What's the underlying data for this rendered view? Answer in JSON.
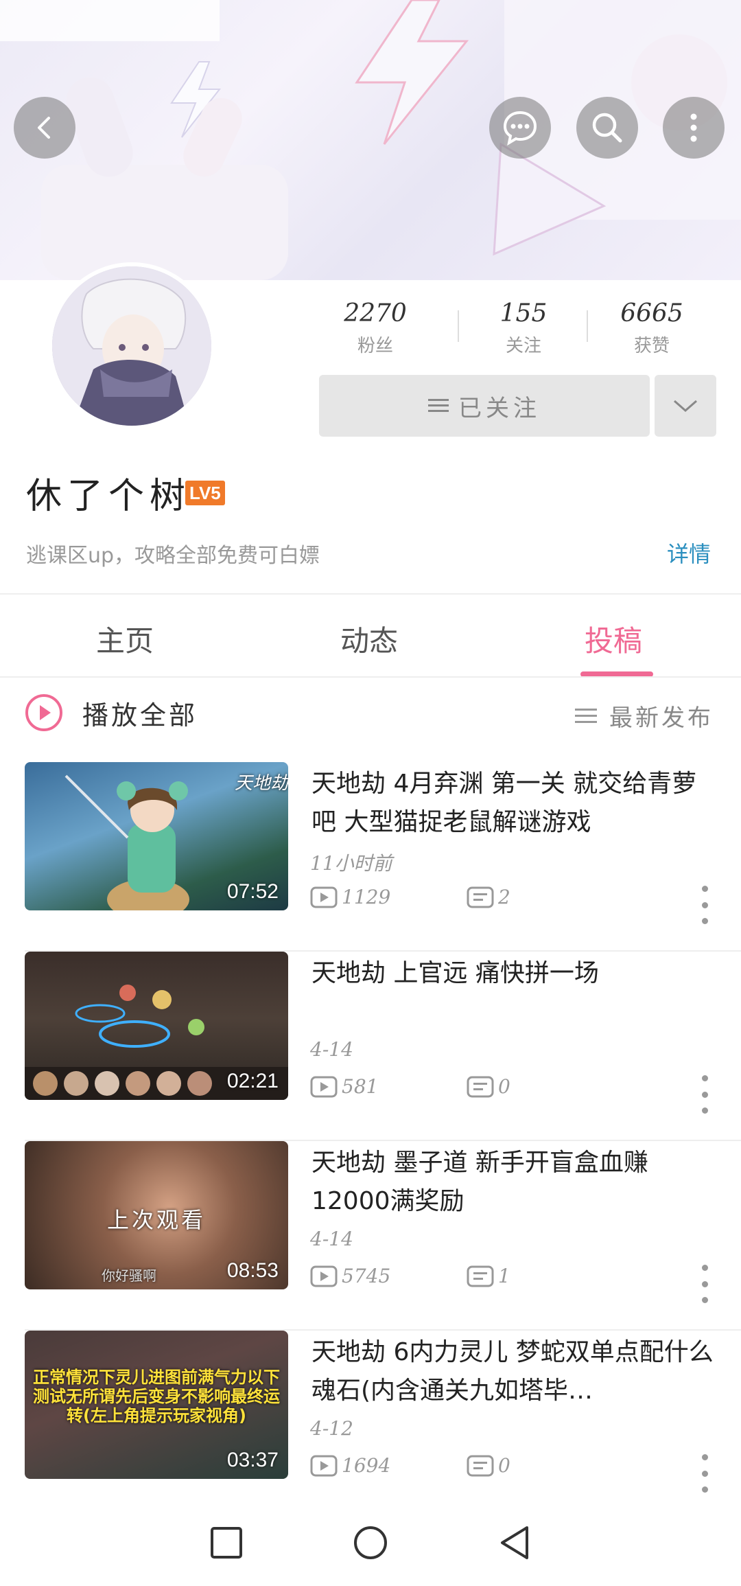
{
  "header": {
    "back_icon": "back-arrow-icon",
    "message_icon": "chat-bubble-icon",
    "search_icon": "search-icon",
    "more_icon": "vertical-dots-icon"
  },
  "profile": {
    "stats": [
      {
        "value": "2270",
        "label": "粉丝"
      },
      {
        "value": "155",
        "label": "关注"
      },
      {
        "value": "6665",
        "label": "获赞"
      }
    ],
    "follow_label": "已关注",
    "username": "休了个树",
    "level": "LV5",
    "bio": "逃课区up，攻略全部免费可白嫖",
    "detail_link": "详情"
  },
  "tabs": [
    {
      "label": "主页",
      "active": false
    },
    {
      "label": "动态",
      "active": false
    },
    {
      "label": "投稿",
      "active": true
    }
  ],
  "list_header": {
    "play_all": "播放全部",
    "sort": "最新发布"
  },
  "videos": [
    {
      "title": "天地劫 4月弃渊 第一关 就交给青萝吧 大型猫捉老鼠解谜游戏",
      "date": "11小时前",
      "duration": "07:52",
      "views": "1129",
      "comments": "2",
      "thumb_text": "天地劫"
    },
    {
      "title": "天地劫 上官远 痛快拼一场",
      "date": "4-14",
      "duration": "02:21",
      "views": "581",
      "comments": "0"
    },
    {
      "title": "天地劫 墨子道 新手开盲盒血赚12000满奖励",
      "date": "4-14",
      "duration": "08:53",
      "views": "5745",
      "comments": "1",
      "thumb_text": "上次观看",
      "thumb_sub": "你好骚啊"
    },
    {
      "title": "天地劫 6内力灵儿 梦蛇双单点配什么魂石(内含通关九如塔毕…",
      "date": "4-12",
      "duration": "03:37",
      "views": "1694",
      "comments": "0",
      "thumb_text": "正常情况下灵儿进图前满气力以下测试无所谓先后变身不影响最终运转(左上角提示玩家视角)"
    }
  ],
  "colors": {
    "accent": "#f06a94",
    "link": "#2b8fbf",
    "level_badge": "#f07a2a"
  }
}
